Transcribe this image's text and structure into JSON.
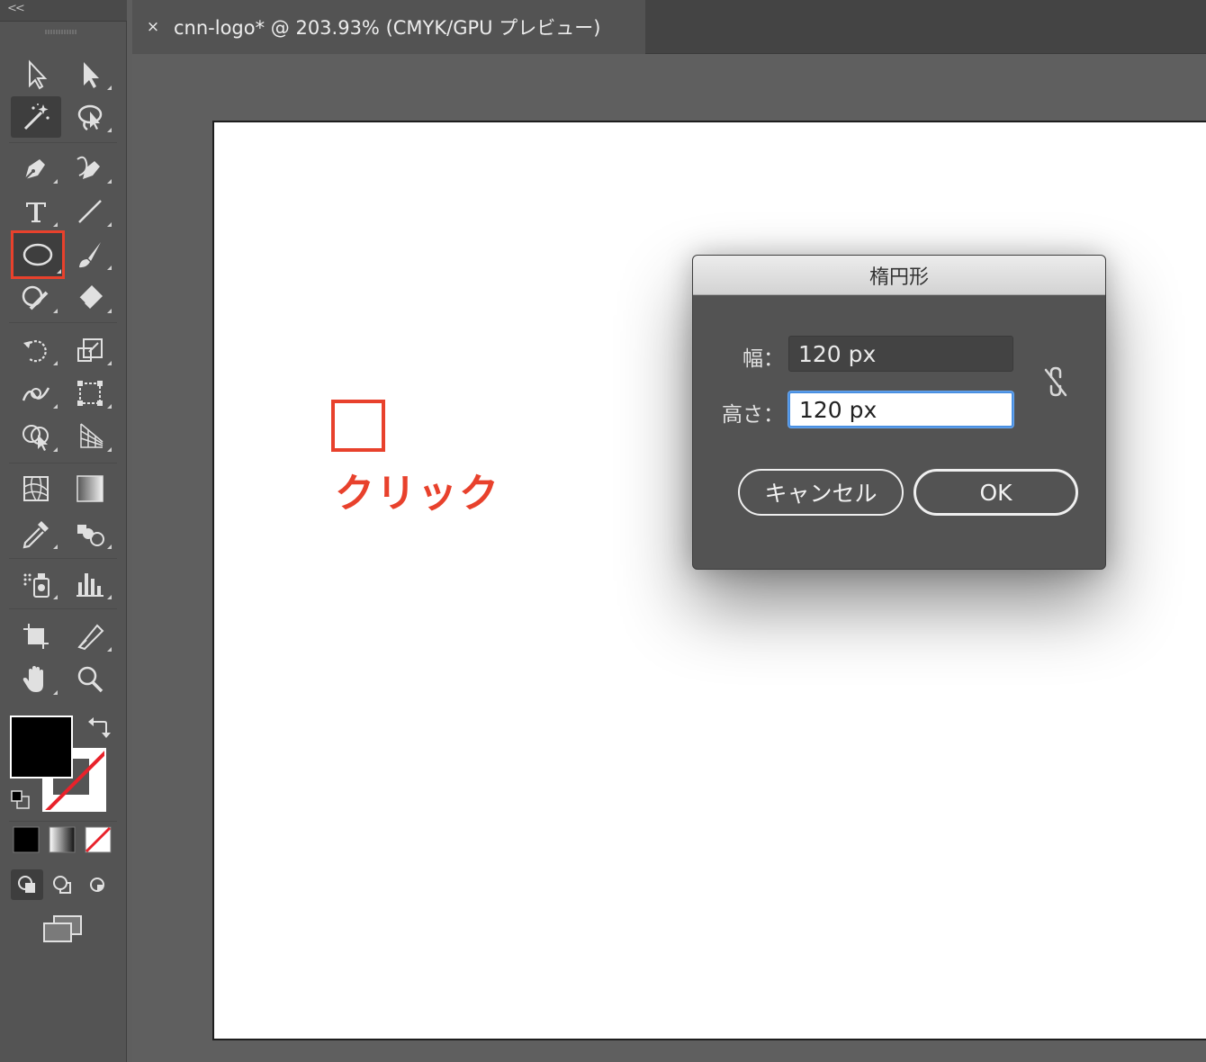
{
  "toolbar": {
    "collapse_glyph": "<<",
    "tools": [
      {
        "name": "selection-tool-icon"
      },
      {
        "name": "direct-selection-tool-icon"
      },
      {
        "name": "magic-wand-tool-icon"
      },
      {
        "name": "lasso-tool-icon"
      },
      {
        "name": "pen-tool-icon"
      },
      {
        "name": "curvature-tool-icon"
      },
      {
        "name": "type-tool-icon"
      },
      {
        "name": "line-segment-tool-icon"
      },
      {
        "name": "ellipse-tool-icon"
      },
      {
        "name": "paintbrush-tool-icon"
      },
      {
        "name": "shaper-tool-icon"
      },
      {
        "name": "eraser-tool-icon"
      },
      {
        "name": "rotate-tool-icon"
      },
      {
        "name": "scale-tool-icon"
      },
      {
        "name": "warp-tool-icon"
      },
      {
        "name": "free-transform-tool-icon"
      },
      {
        "name": "shape-builder-tool-icon"
      },
      {
        "name": "perspective-grid-tool-icon"
      },
      {
        "name": "mesh-tool-icon"
      },
      {
        "name": "gradient-tool-icon"
      },
      {
        "name": "eyedropper-tool-icon"
      },
      {
        "name": "blend-tool-icon"
      },
      {
        "name": "symbol-sprayer-tool-icon"
      },
      {
        "name": "column-graph-tool-icon"
      },
      {
        "name": "artboard-tool-icon"
      },
      {
        "name": "slice-tool-icon"
      },
      {
        "name": "hand-tool-icon"
      },
      {
        "name": "zoom-tool-icon"
      }
    ],
    "fill_color": "#000000",
    "stroke_color": "none"
  },
  "tab": {
    "close_glyph": "×",
    "title": "cnn-logo* @ 203.93% (CMYK/GPU プレビュー)"
  },
  "annotation": {
    "label": "クリック",
    "color": "#e8412c"
  },
  "dialog": {
    "title": "楕円形",
    "width_label": "幅：",
    "width_value": "120 px",
    "height_label": "高さ：",
    "height_value": "120 px",
    "cancel_label": "キャンセル",
    "ok_label": "OK"
  }
}
